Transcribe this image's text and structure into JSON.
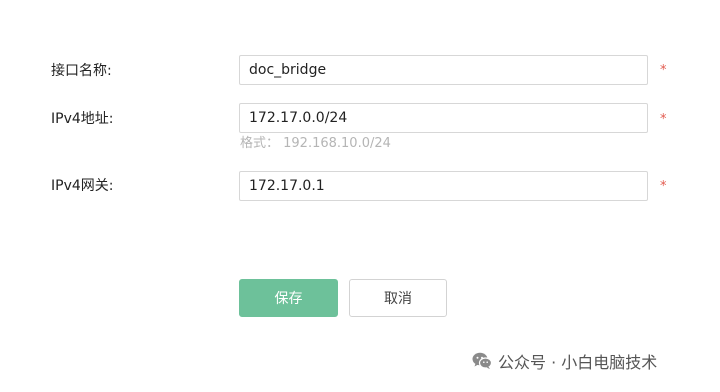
{
  "form": {
    "interface_name": {
      "label": "接口名称:",
      "value": "doc_bridge",
      "required_mark": "*"
    },
    "ipv4_address": {
      "label": "IPv4地址:",
      "value": "172.17.0.0/24",
      "required_mark": "*",
      "hint": "格式： 192.168.10.0/24"
    },
    "ipv4_gateway": {
      "label": "IPv4网关:",
      "value": "172.17.0.1",
      "required_mark": "*"
    }
  },
  "buttons": {
    "save_label": "保存",
    "cancel_label": "取消"
  },
  "watermark": {
    "icon": "wechat-icon",
    "text": "公众号 · 小白电脑技术"
  },
  "colors": {
    "save_button": "#6dc19a",
    "required_mark": "#e25b4f",
    "hint_text": "#b5b5b5"
  }
}
